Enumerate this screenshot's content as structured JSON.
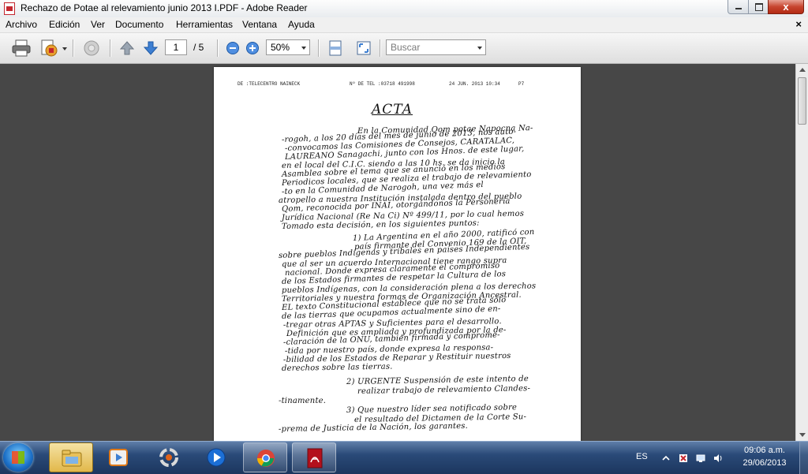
{
  "window": {
    "title": "Rechazo de Potae al relevamiento junio 2013  I.PDF - Adobe Reader",
    "close_label": "x",
    "doc_close_label": "×"
  },
  "menu": {
    "items": [
      "Archivo",
      "Edición",
      "Ver",
      "Documento",
      "Herramientas",
      "Ventana",
      "Ayuda"
    ]
  },
  "toolbar": {
    "current_page": "1",
    "total_pages": "/ 5",
    "zoom": "50%",
    "search_placeholder": "Buscar"
  },
  "document": {
    "fax_header": {
      "sender": "DE :TELECENTRO NAINECK",
      "phone": "Nº DE TEL :03718 491998",
      "date": "24 JUN. 2013 10:34",
      "page": "P7"
    },
    "title": "ACTA",
    "lines": [
      "En la Comunidad Qom potae Napocna Na-",
      "-rogoh, a los 20 días del mes de junio de 2013, nos auto-",
      "-convocamos las Comisiones de Consejos, CARATALAC,",
      "LAUREANO Sanagachi, junto con los Hnos. de este lugar,",
      "en el local del C.I.C. siendo a las 10 hs. se da inicio la",
      "Asamblea sobre el tema que se anunció en los medios",
      "Periodicos locales, que se realiza el trabajo de relevamiento",
      "-to en la Comunidad de Narogoh, una vez más el",
      "atropello a nuestra Institución instalada dentro del pueblo",
      "Qom, reconocida por INAI, otorgándonos la Personería",
      "Jurídica Nacional (Re Na Ci) Nº 499/11, por lo cual hemos",
      "Tomado esta decisión, en los siguientes puntos:",
      "1) La Argentina en el año 2000, ratificó con",
      "país firmante del Convenio 169 de la OIT,",
      "sobre pueblos Indígenas y tribales en países Independientes",
      "que al ser un acuerdo Internacional tiene rango supra",
      "nacional. Donde expresa claramente el compromiso",
      "de los Estados firmantes de respetar la Cultura de los",
      "pueblos Indígenas, con la consideración plena a los derechos",
      "Territoriales y nuestra formas de Organización Ancestral.",
      "EL texto Constitucional establece que no se trata sólo",
      "de las tierras que ocupamos actualmente sino de en-",
      "-tregar otras APTAS y Suficientes para el desarrollo.",
      "Definición que es ampliada y profundizada por la de-",
      "-claración de la ONU, también firmada y comprome-",
      "-tida por nuestro país, donde expresa la responsa-",
      "-bilidad de los Estados de Reparar y Restituir nuestros",
      "derechos sobre las tierras.",
      "2) URGENTE Suspensión de este intento de",
      "realizar trabajo de relevamiento Clandes-",
      "-tinamente.",
      "3) Que nuestro líder sea notificado sobre",
      "el resultado del Dictamen de la Corte Su-",
      "-prema de Justicia de la Nación, los garantes."
    ]
  },
  "tray": {
    "language": "ES",
    "time": "09:06 a.m.",
    "date": "29/06/2013"
  },
  "colors": {
    "taskbar": "#2a4a78",
    "doc_background": "#474747",
    "close_button": "#c7452f"
  }
}
